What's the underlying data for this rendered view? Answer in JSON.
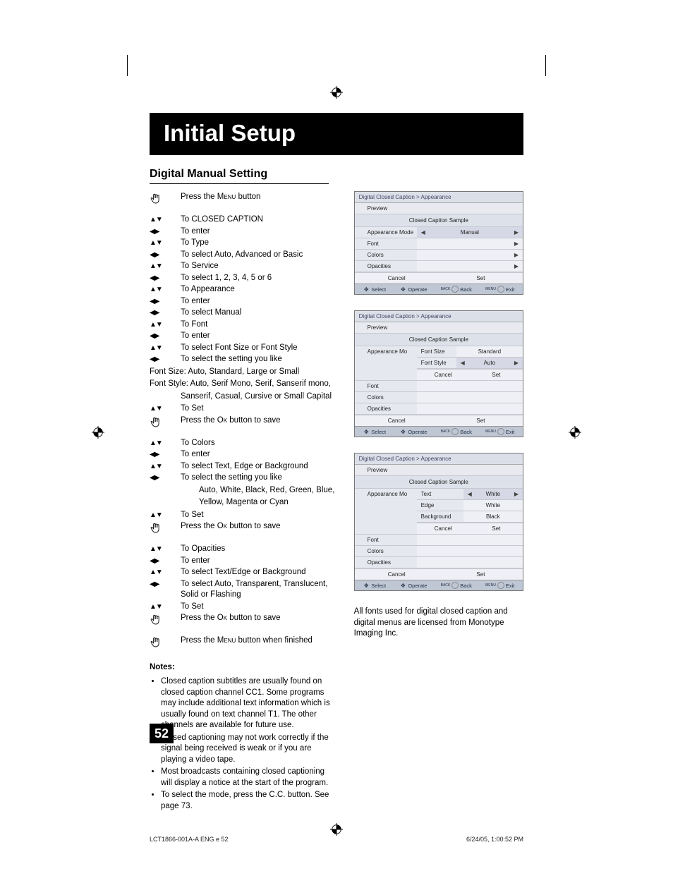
{
  "title_bar": "Initial Setup",
  "section_title": "Digital Manual Setting",
  "glyphs": {
    "hand": "hand",
    "ud": "▲▼",
    "lr": "◀▶"
  },
  "steps": [
    {
      "icon": "hand",
      "pre": "Press the ",
      "sc": "Menu",
      "post": " button"
    },
    {
      "icon": "ud",
      "text": "To CLOSED CAPTION"
    },
    {
      "icon": "lr",
      "text": "To enter"
    },
    {
      "icon": "ud",
      "text": "To Type"
    },
    {
      "icon": "lr",
      "text": "To select Auto, Advanced or Basic"
    },
    {
      "icon": "ud",
      "text": "To Service"
    },
    {
      "icon": "lr",
      "text": "To select 1, 2, 3, 4, 5 or 6"
    },
    {
      "icon": "ud",
      "text": "To Appearance"
    },
    {
      "icon": "lr",
      "text": "To enter"
    },
    {
      "icon": "lr",
      "text": "To select Manual"
    },
    {
      "icon": "ud",
      "text": "To Font"
    },
    {
      "icon": "lr",
      "text": "To enter"
    },
    {
      "icon": "ud",
      "text": "To select Font Size or Font Style"
    },
    {
      "icon": "lr",
      "text": "To select the setting you like"
    }
  ],
  "para_fontsize": "Font Size: Auto, Standard, Large or Small",
  "para_fontstyle_a": "Font Style: Auto, Serif Mono, Serif, Sanserif mono,",
  "para_fontstyle_b": "Sanserif, Casual, Cursive or Small Capital",
  "steps2": [
    {
      "icon": "ud",
      "text": "To Set"
    },
    {
      "icon": "hand",
      "pre": "Press the ",
      "sc": "Ok",
      "post": " button to save"
    },
    {
      "icon": "ud",
      "text": "To Colors"
    },
    {
      "icon": "lr",
      "text": "To enter"
    },
    {
      "icon": "ud",
      "text": "To select Text, Edge or Background"
    },
    {
      "icon": "lr",
      "text": "To select the setting you like"
    }
  ],
  "color_opts_a": "Auto, White, Black, Red, Green, Blue,",
  "color_opts_b": "Yellow, Magenta or Cyan",
  "steps3": [
    {
      "icon": "ud",
      "text": "To Set"
    },
    {
      "icon": "hand",
      "pre": "Press the ",
      "sc": "Ok",
      "post": " button to save"
    },
    {
      "icon": "ud",
      "text": "To Opacities"
    },
    {
      "icon": "lr",
      "text": "To enter"
    },
    {
      "icon": "ud",
      "text": "To select Text/Edge or Background"
    },
    {
      "icon": "lr",
      "text": "To select Auto, Transparent, Translucent, Solid or Flashing"
    },
    {
      "icon": "ud",
      "text": "To Set"
    },
    {
      "icon": "hand",
      "pre": "Press the ",
      "sc": "Ok",
      "post": " button to save"
    },
    {
      "icon": "hand",
      "pre": "Press the ",
      "sc": "Menu",
      "post": " button when finished"
    }
  ],
  "notes_heading": "Notes:",
  "notes": [
    "Closed caption subtitles are usually found on closed caption channel CC1. Some programs may include additional text information which is usually found on text channel T1. The other channels are available for future use.",
    "Closed captioning may not work correctly if the signal being received is weak or if you are playing a video tape.",
    "Most broadcasts containing closed captioning will display a notice at the start of the program.",
    "To select the mode, press the C.C. button. See page 73."
  ],
  "page_number": "52",
  "footer_left": "LCT1866-001A-A ENG e   52",
  "footer_right": "6/24/05, 1:00:52 PM",
  "osd_breadcrumb": "Digital Closed Caption  >  Appearance",
  "osd_preview": "Preview",
  "osd_sample": "Closed Caption Sample",
  "osd_labels": {
    "am": "Appearance Mode",
    "amShort": "Appearance Mo",
    "font": "Font",
    "colors": "Colors",
    "opac": "Opacities",
    "cancel": "Cancel",
    "set": "Set"
  },
  "osd_footer": {
    "select": "Select",
    "operate": "Operate",
    "back": "Back",
    "exit": "Exit",
    "backSup": "BACK",
    "menuSup": "MENU"
  },
  "osd1": {
    "am_val": "Manual"
  },
  "osd2": {
    "fontsize": "Font Size",
    "fontstyle": "Font Style",
    "standard": "Standard",
    "auto": "Auto"
  },
  "osd3": {
    "text": "Text",
    "edge": "Edge",
    "background": "Background",
    "white": "White",
    "black": "Black"
  },
  "license": "All fonts used for digital closed caption and digital menus are licensed from Monotype Imaging Inc."
}
